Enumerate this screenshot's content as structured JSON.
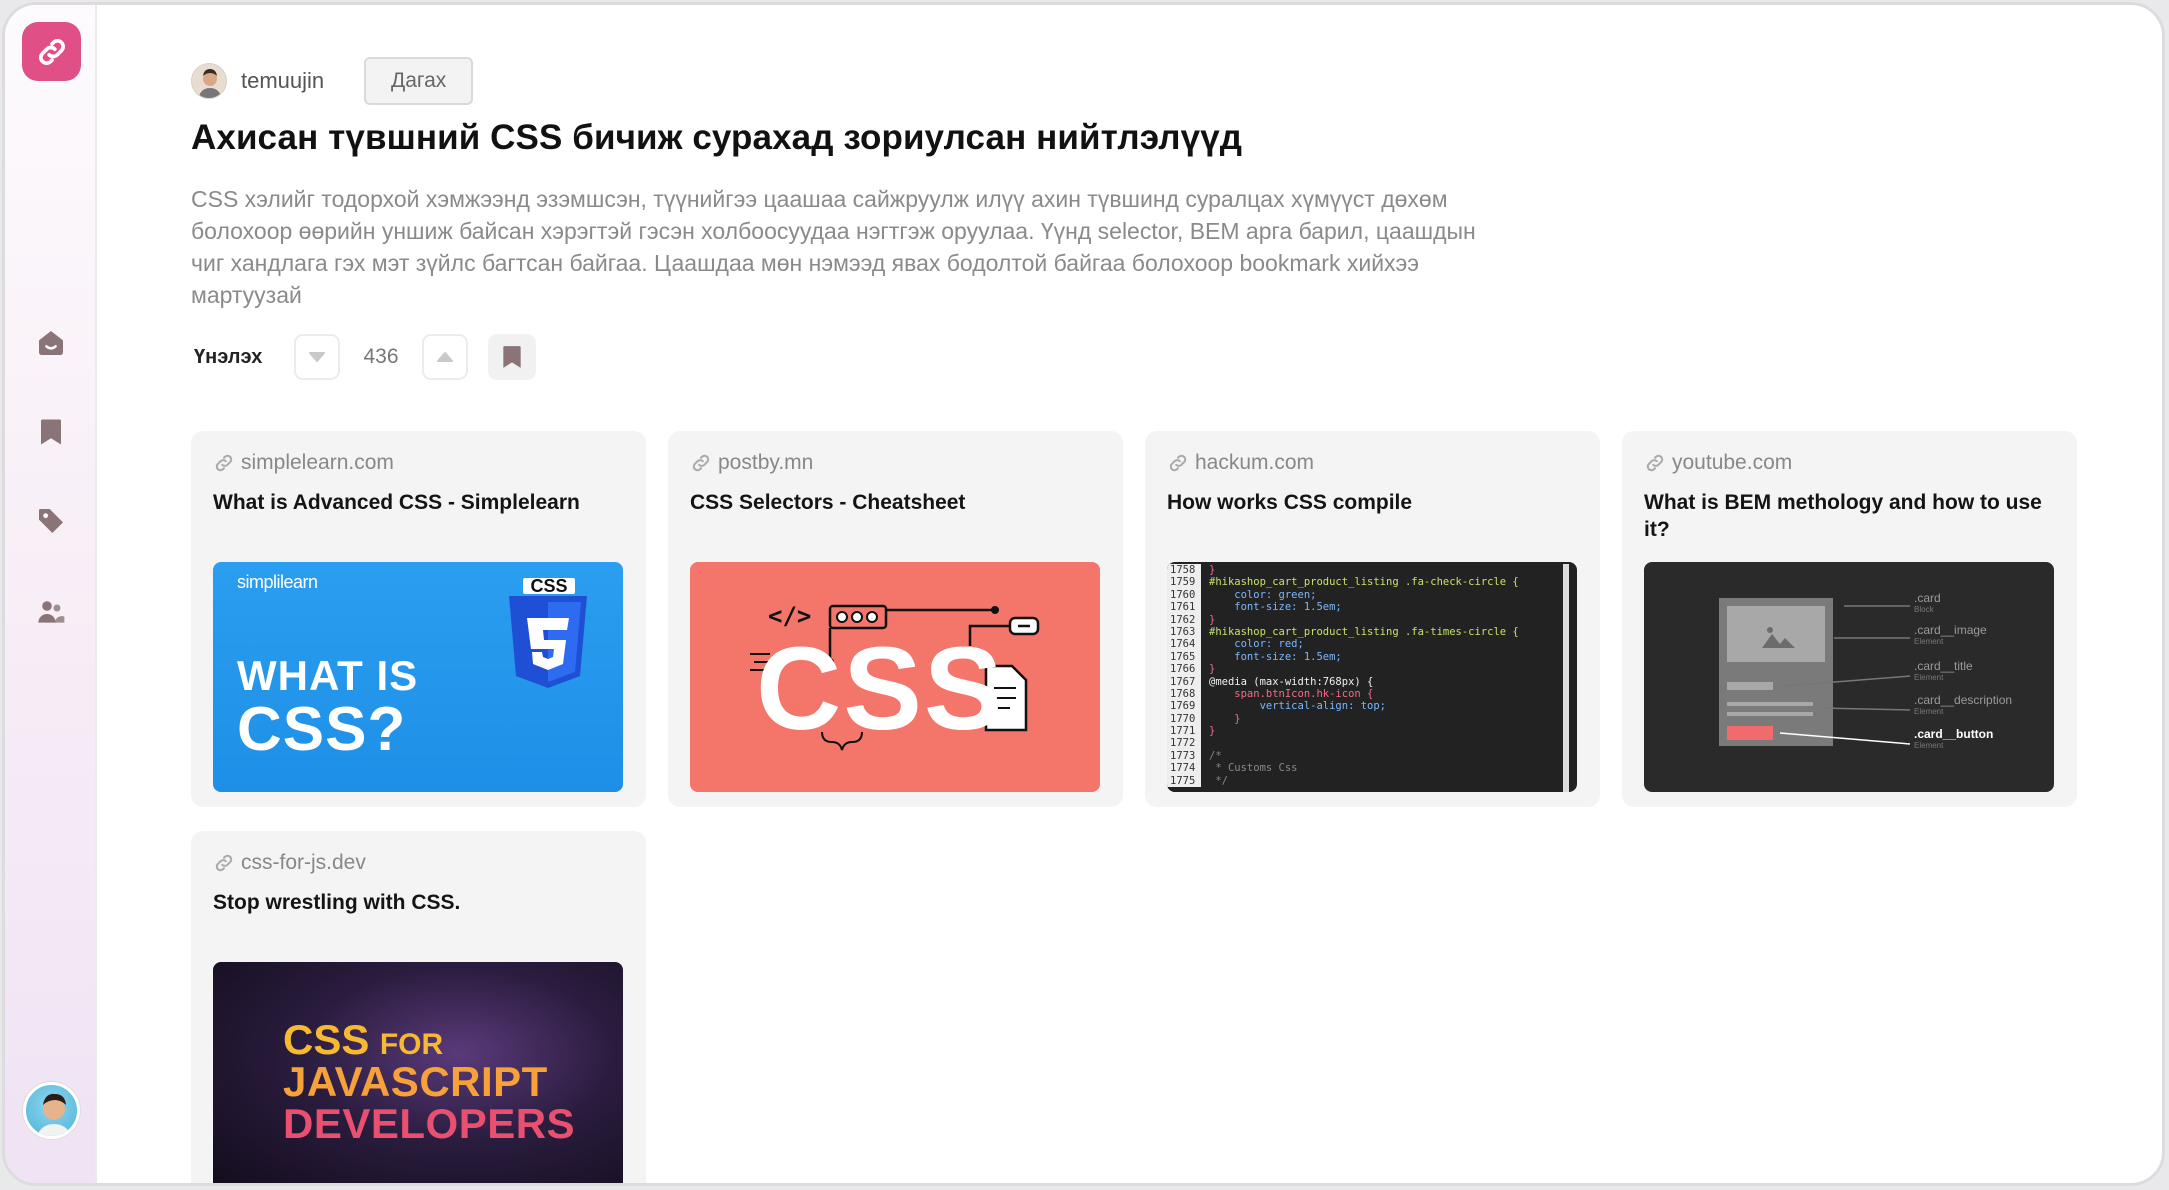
{
  "author": {
    "username": "temuujin",
    "follow_label": "Дагах"
  },
  "page": {
    "title": "Ахисан түвшний CSS бичиж сурахад зориулсан нийтлэлүүд",
    "description": "CSS хэлийг тодорхой хэмжээнд эзэмшсэн, түүнийгээ цаашаа сайжруулж илүү ахин түвшинд суралцах хүмүүст дөхөм болохоор өөрийн уншиж байсан хэрэгтэй гэсэн холбоосуудаа нэгтгэж оруулаа. Үүнд selector, BEM арга барил, цаашдын чиг хандлага гэх мэт зүйлс багтсан байгаа. Цаашдаа мөн нэмээд явах бодолтой байгаа болохоор bookmark хийхээ мартуузай"
  },
  "rating": {
    "label": "Үнэлэх",
    "count": "436"
  },
  "sidebar": {
    "icons": [
      "link-icon",
      "home-icon",
      "bookmark-icon",
      "tag-icon",
      "users-icon"
    ]
  },
  "cards": [
    {
      "domain": "simplelearn.com",
      "title": "What is Advanced CSS - Simplelearn",
      "thumb": {
        "brand": "simplilearn",
        "badge": "CSS",
        "line1": "WHAT IS",
        "line2": "CSS?"
      }
    },
    {
      "domain": "postby.mn",
      "title": "CSS Selectors - Cheatsheet",
      "thumb": {
        "code_tag": "</>",
        "big_text": "CSS"
      }
    },
    {
      "domain": "hackum.com",
      "title": "How works CSS compile",
      "thumb": {
        "lines": [
          {
            "n": "1758",
            "t": "}"
          },
          {
            "n": "1759",
            "t": "#hikashop_cart_product_listing .fa-check-circle {"
          },
          {
            "n": "1760",
            "t": "    color: green;"
          },
          {
            "n": "1761",
            "t": "    font-size: 1.5em;"
          },
          {
            "n": "1762",
            "t": "}"
          },
          {
            "n": "1763",
            "t": "#hikashop_cart_product_listing .fa-times-circle {"
          },
          {
            "n": "1764",
            "t": "    color: red;"
          },
          {
            "n": "1765",
            "t": "    font-size: 1.5em;"
          },
          {
            "n": "1766",
            "t": "}"
          },
          {
            "n": "1767",
            "t": "@media (max-width:768px) {"
          },
          {
            "n": "1768",
            "t": "    span.btnIcon.hk-icon {"
          },
          {
            "n": "1769",
            "t": "        vertical-align: top;"
          },
          {
            "n": "1770",
            "t": "    }"
          },
          {
            "n": "1771",
            "t": "}"
          },
          {
            "n": "1772",
            "t": ""
          },
          {
            "n": "1773",
            "t": "/*"
          },
          {
            "n": "1774",
            "t": " * Customs Css"
          },
          {
            "n": "1775",
            "t": " */"
          }
        ]
      }
    },
    {
      "domain": "youtube.com",
      "title": "What is BEM methology and how to use it?",
      "thumb": {
        "labels": [
          {
            "name": ".card",
            "kind": "Block"
          },
          {
            "name": ".card__image",
            "kind": "Element"
          },
          {
            "name": ".card__title",
            "kind": "Element"
          },
          {
            "name": ".card__description",
            "kind": "Element"
          },
          {
            "name": ".card__button",
            "kind": "Element"
          }
        ]
      }
    },
    {
      "domain": "css-for-js.dev",
      "title": "Stop wrestling with CSS.",
      "thumb": {
        "line1a": "CSS",
        "line1b": "FOR",
        "line2": "JAVASCRIPT",
        "line3": "DEVELOPERS"
      }
    }
  ],
  "colors": {
    "brand": "#e14f87",
    "sidebar_icon": "#8a7478",
    "card_bg": "#f4f4f5"
  }
}
